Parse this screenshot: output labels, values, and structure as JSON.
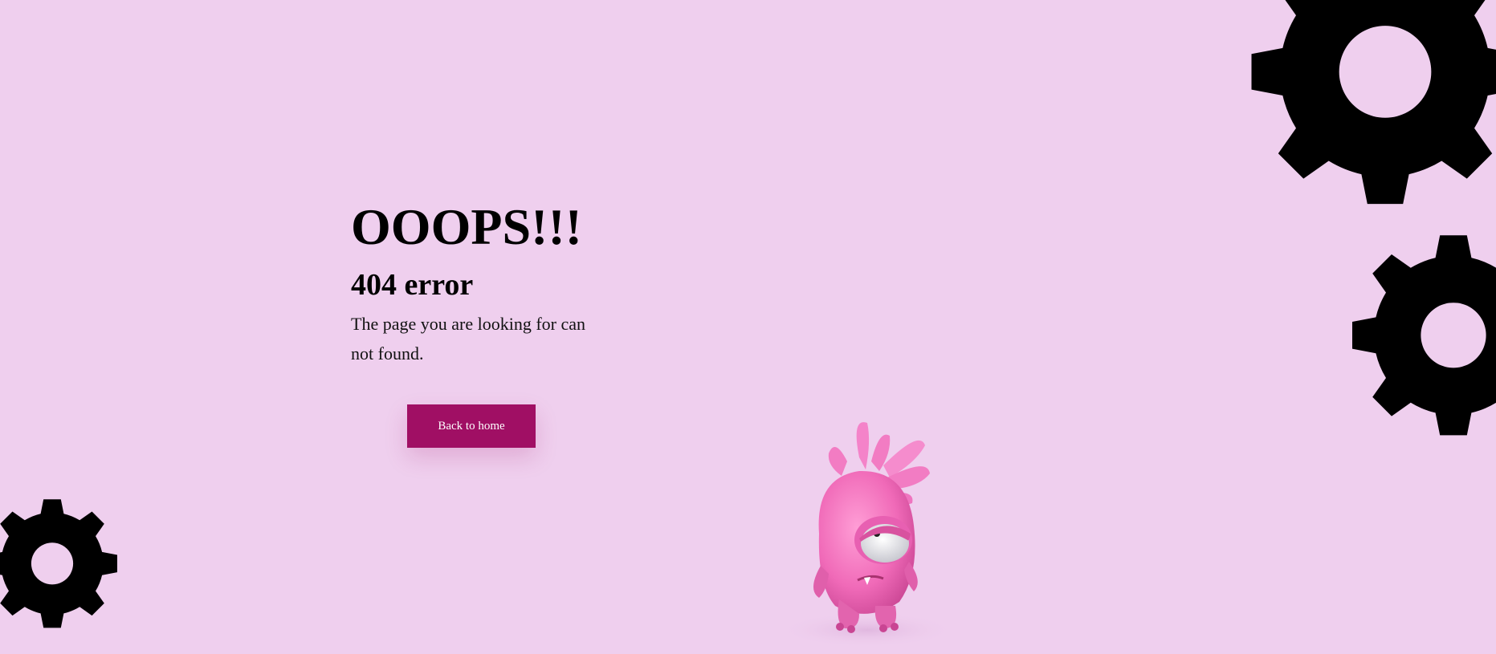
{
  "page": {
    "background_color": "#efcfee",
    "accent_color": "#a00f64"
  },
  "error": {
    "headline": "OOOPS!!!",
    "code_text": "404 error",
    "message": "The page you are looking for can not found."
  },
  "actions": {
    "back_home_label": "Back to home"
  },
  "decorations": {
    "gears": [
      "gear-icon",
      "gear-icon",
      "gear-icon"
    ],
    "mascot": "pink-monster-illustration"
  }
}
